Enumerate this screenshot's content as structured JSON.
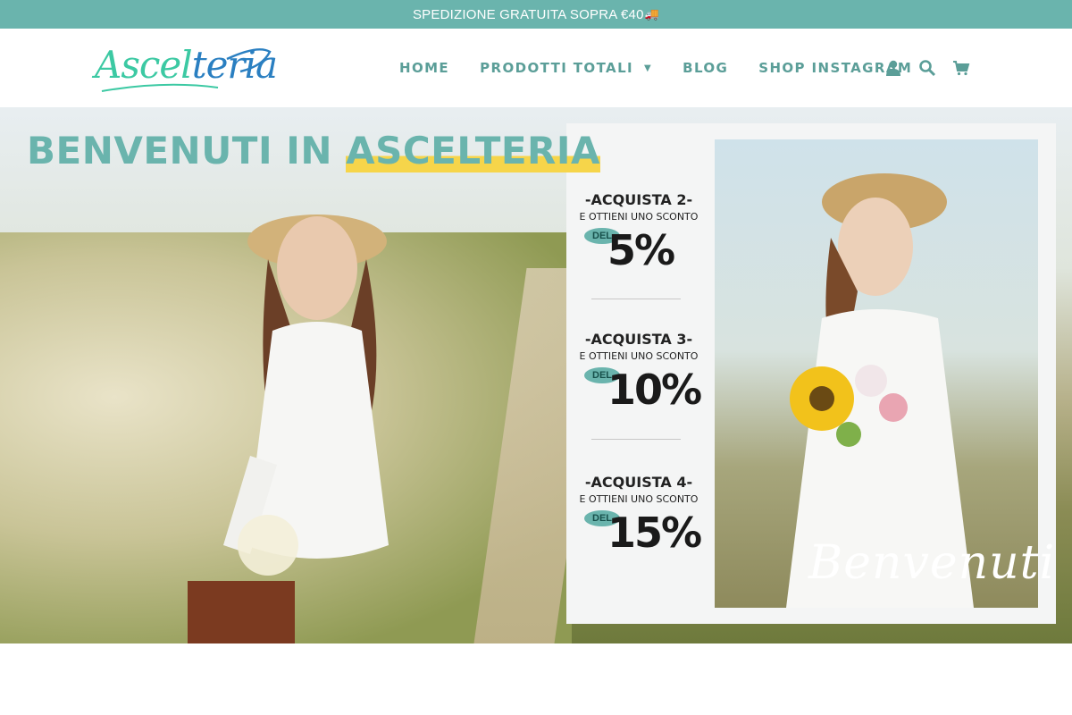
{
  "announcement": {
    "text": "SPEDIZIONE GRATUITA SOPRA €40",
    "icon": "delivery-truck-icon"
  },
  "brand": {
    "logo_text_a": "Ascel",
    "logo_text_b": "teria",
    "primary": "#6ab4ad",
    "accent": "#2a7fc1"
  },
  "nav": {
    "items": [
      {
        "label": "HOME"
      },
      {
        "label": "PRODOTTI TOTALI",
        "has_dropdown": true
      },
      {
        "label": "BLOG"
      },
      {
        "label": "SHOP INSTAGRAM"
      }
    ]
  },
  "header_icons": [
    "user-account-icon",
    "search-icon",
    "cart-icon"
  ],
  "hero": {
    "title_part1": "BENVENUTI IN ",
    "title_part2": "ASCELTERIA",
    "promos": [
      {
        "line1": "-ACQUISTA 2-",
        "line2": "E OTTIENI UNO SCONTO",
        "badge": "DEL",
        "percent": "5%"
      },
      {
        "line1": "-ACQUISTA 3-",
        "line2": "E OTTIENI UNO SCONTO",
        "badge": "DEL",
        "percent": "10%"
      },
      {
        "line1": "-ACQUISTA 4-",
        "line2": "E OTTIENI UNO SCONTO",
        "badge": "DEL",
        "percent": "15%"
      }
    ],
    "script_text": "Benvenuti"
  }
}
